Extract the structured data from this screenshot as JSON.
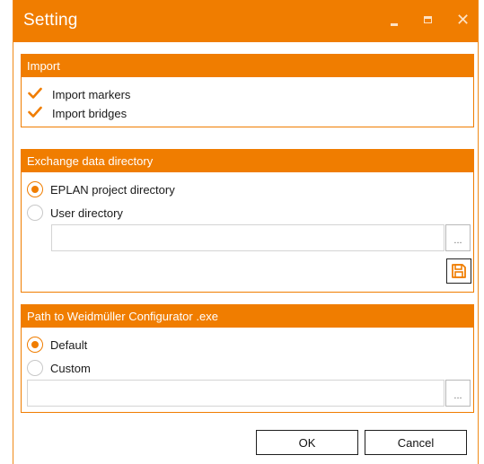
{
  "window": {
    "title": "Setting",
    "controls": {
      "minimize_icon": "minimize-icon",
      "maximize_icon": "maximize-icon",
      "close_icon": "close-icon",
      "close_glyph": "✕"
    },
    "accent_color": "#f07d00"
  },
  "import_group": {
    "header": "Import",
    "items": [
      {
        "label": "Import markers",
        "checked": true
      },
      {
        "label": "Import bridges",
        "checked": true
      }
    ]
  },
  "exchange_group": {
    "header": "Exchange data directory",
    "options": [
      {
        "label": "EPLAN project directory",
        "selected": true
      },
      {
        "label": "User directory",
        "selected": false
      }
    ],
    "path_value": "",
    "browse_label": "...",
    "save_icon": "save-icon"
  },
  "configurator_group": {
    "header": "Path to Weidmüller Configurator .exe",
    "options": [
      {
        "label": "Default",
        "selected": true
      },
      {
        "label": "Custom",
        "selected": false
      }
    ],
    "path_value": "",
    "browse_label": "..."
  },
  "footer": {
    "ok_label": "OK",
    "cancel_label": "Cancel"
  }
}
